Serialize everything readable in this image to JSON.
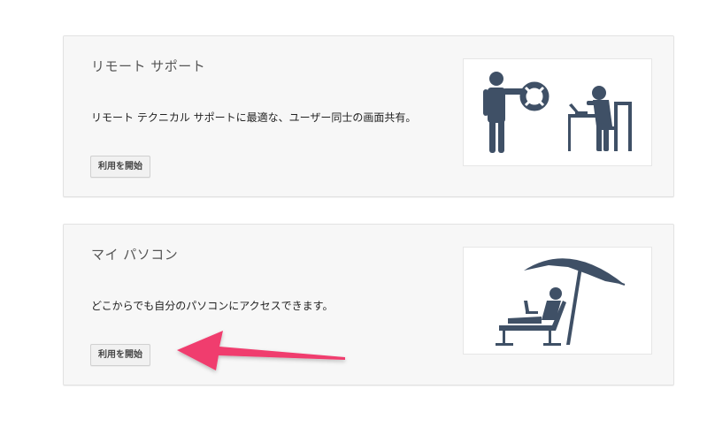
{
  "cards": [
    {
      "title": "リモート サポート",
      "description": "リモート テクニカル サポートに最適な、ユーザー同士の画面共有。",
      "button_label": "利用を開始",
      "illustration": "remote-support-illustration"
    },
    {
      "title": "マイ パソコン",
      "description": "どこからでも自分のパソコンにアクセスできます。",
      "button_label": "利用を開始",
      "illustration": "beach-laptop-illustration"
    }
  ],
  "annotation": {
    "arrow_color": "#f03c6e",
    "points_to": "my-computer-start-button"
  },
  "colors": {
    "figure": "#3f5066",
    "card_bg": "#f7f7f7",
    "card_border": "#e2e2e2"
  }
}
